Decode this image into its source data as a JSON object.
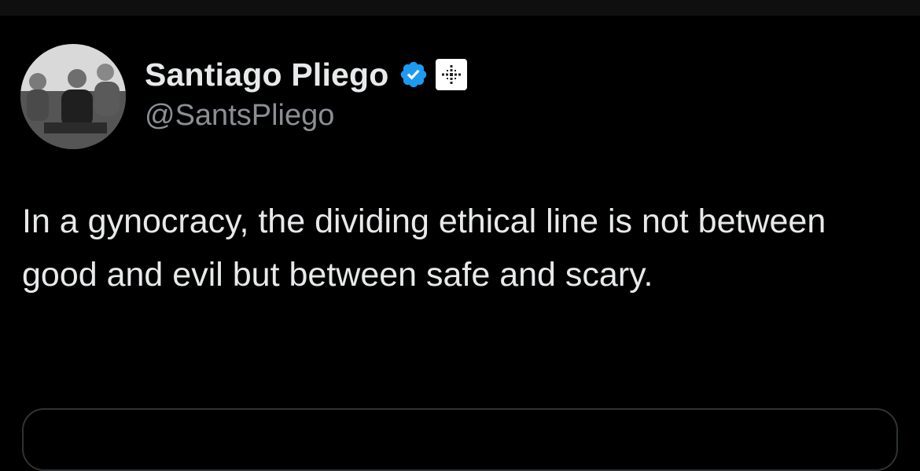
{
  "tweet": {
    "author": {
      "display_name": "Santiago Pliego",
      "handle": "@SantsPliego",
      "avatar_icon": "profile-photo",
      "verified_icon": "verified-badge-icon",
      "affiliate_icon": "affiliate-badge-icon"
    },
    "text": "In a gynocracy, the dividing ethical line is not between good and evil but between safe and scary."
  },
  "colors": {
    "background": "#000000",
    "text_primary": "#e7e9ea",
    "text_secondary": "#8b8f94",
    "verified_blue": "#1d9bf0",
    "border": "#2f3336"
  }
}
